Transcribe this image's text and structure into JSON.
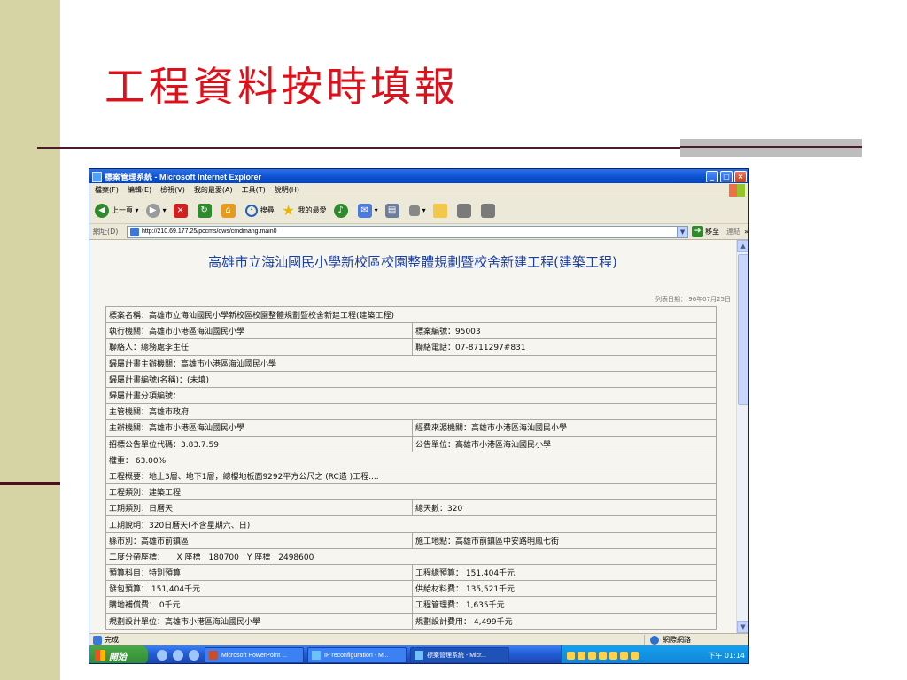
{
  "slide": {
    "title": "工程資料按時填報"
  },
  "browser": {
    "window_title": "標案管理系統 - Microsoft Internet Explorer",
    "menu": [
      "檔案(F)",
      "編輯(E)",
      "檢視(V)",
      "我的最愛(A)",
      "工具(T)",
      "說明(H)"
    ],
    "toolbar": {
      "back_label": "上一頁",
      "search_label": "搜尋",
      "favorites_label": "我的最愛"
    },
    "address": {
      "label": "網址(D)",
      "url": "http://210.69.177.25/pccms/ows/cmdmang.main0",
      "go_label": "移至",
      "links_label": "連結"
    },
    "status": {
      "text": "完成",
      "zone": "網際網路"
    }
  },
  "page": {
    "doc_title": "高雄市立海汕國民小學新校區校園整體規劃暨校舍新建工程(建築工程)",
    "print_date": "列表日期： 96年07月25日",
    "rows": [
      [
        "標案名稱：高雄市立海汕國民小學新校區校園整體規劃暨校舍新建工程(建築工程)"
      ],
      [
        "執行機關：高雄市小港區海汕國民小學",
        "標案編號：95003"
      ],
      [
        "聯絡人：總務處李主任",
        "聯絡電話：07-8711297#831"
      ],
      [
        "歸屬計畫主辦機關：高雄市小港區海汕國民小學"
      ],
      [
        "歸屬計畫編號(名稱)：(未填)"
      ],
      [
        "歸屬計畫分項編號："
      ],
      [
        "主管機關：高雄市政府"
      ],
      [
        "主辦機關：高雄市小港區海汕國民小學",
        "經費來源機關：高雄市小港區海汕國民小學"
      ],
      [
        "招標公告單位代碼：3.83.7.59",
        "公告單位：高雄市小港區海汕國民小學"
      ],
      [
        "權重： 63.00%"
      ],
      [
        "工程概要：地上3層、地下1層，總樓地板面9292平方公尺之 (RC造 )工程...."
      ],
      [
        "工程類別：建築工程"
      ],
      [
        "工期類別：日曆天",
        "總天數：320"
      ],
      [
        "工期說明：320日曆天(不含星期六、日)"
      ],
      [
        "縣市別：高雄市前鎮區",
        "施工地點：高雄市前鎮區中安路明鳳七街"
      ],
      [
        "二度分帶座標：　　X 座標　180700　Y 座標　2498600"
      ],
      [
        "預算科目：特別預算",
        "工程總預算： 151,404千元"
      ],
      [
        "發包預算： 151,404千元",
        "供給材料費： 135,521千元"
      ],
      [
        "購地補償費： 0千元",
        "工程管理費： 1,635千元"
      ],
      [
        "規劃設計單位：高雄市小港區海汕國民小學",
        "規劃設計費用： 4,499千元"
      ]
    ]
  },
  "taskbar": {
    "start_label": "開始",
    "tasks": [
      "Microsoft PowerPoint ...",
      "IP reconfiguration - M...",
      "標案管理系統 - Micr..."
    ],
    "clock": "下午 01:14"
  }
}
